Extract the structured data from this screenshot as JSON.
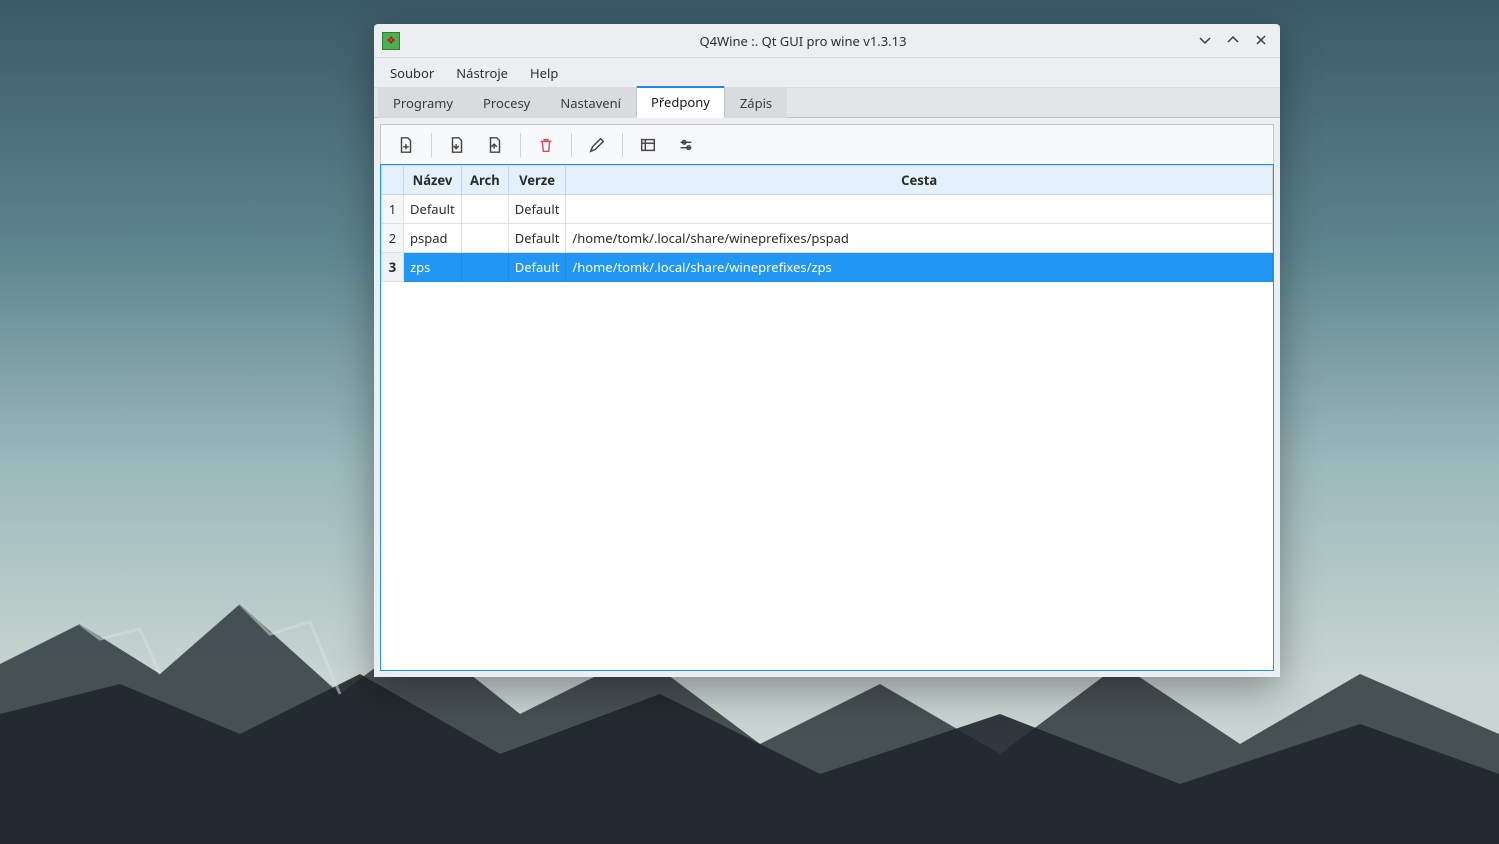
{
  "window": {
    "title": "Q4Wine :. Qt GUI pro wine v1.3.13"
  },
  "menubar": {
    "items": [
      "Soubor",
      "Nástroje",
      "Help"
    ]
  },
  "tabs": {
    "items": [
      "Programy",
      "Procesy",
      "Nastavení",
      "Předpony",
      "Zápis"
    ],
    "active_index": 3
  },
  "toolbar": {
    "items": [
      {
        "name": "new-prefix-icon"
      },
      {
        "name": "import-prefix-icon"
      },
      {
        "name": "export-prefix-icon"
      },
      {
        "sep": true
      },
      {
        "name": "delete-icon",
        "danger": true
      },
      {
        "sep": true
      },
      {
        "name": "edit-icon"
      },
      {
        "sep": true
      },
      {
        "name": "terminal-icon"
      },
      {
        "name": "settings-sliders-icon"
      }
    ]
  },
  "table": {
    "columns": [
      "Název",
      "Arch",
      "Verze",
      "Cesta"
    ],
    "rows": [
      {
        "num": "1",
        "name": "Default",
        "arch": "",
        "ver": "Default",
        "path": "",
        "selected": false
      },
      {
        "num": "2",
        "name": "pspad",
        "arch": "",
        "ver": "Default",
        "path": "/home/tomk/.local/share/wineprefixes/pspad",
        "selected": false
      },
      {
        "num": "3",
        "name": "zps",
        "arch": "",
        "ver": "Default",
        "path": "/home/tomk/.local/share/wineprefixes/zps",
        "selected": true
      }
    ]
  }
}
